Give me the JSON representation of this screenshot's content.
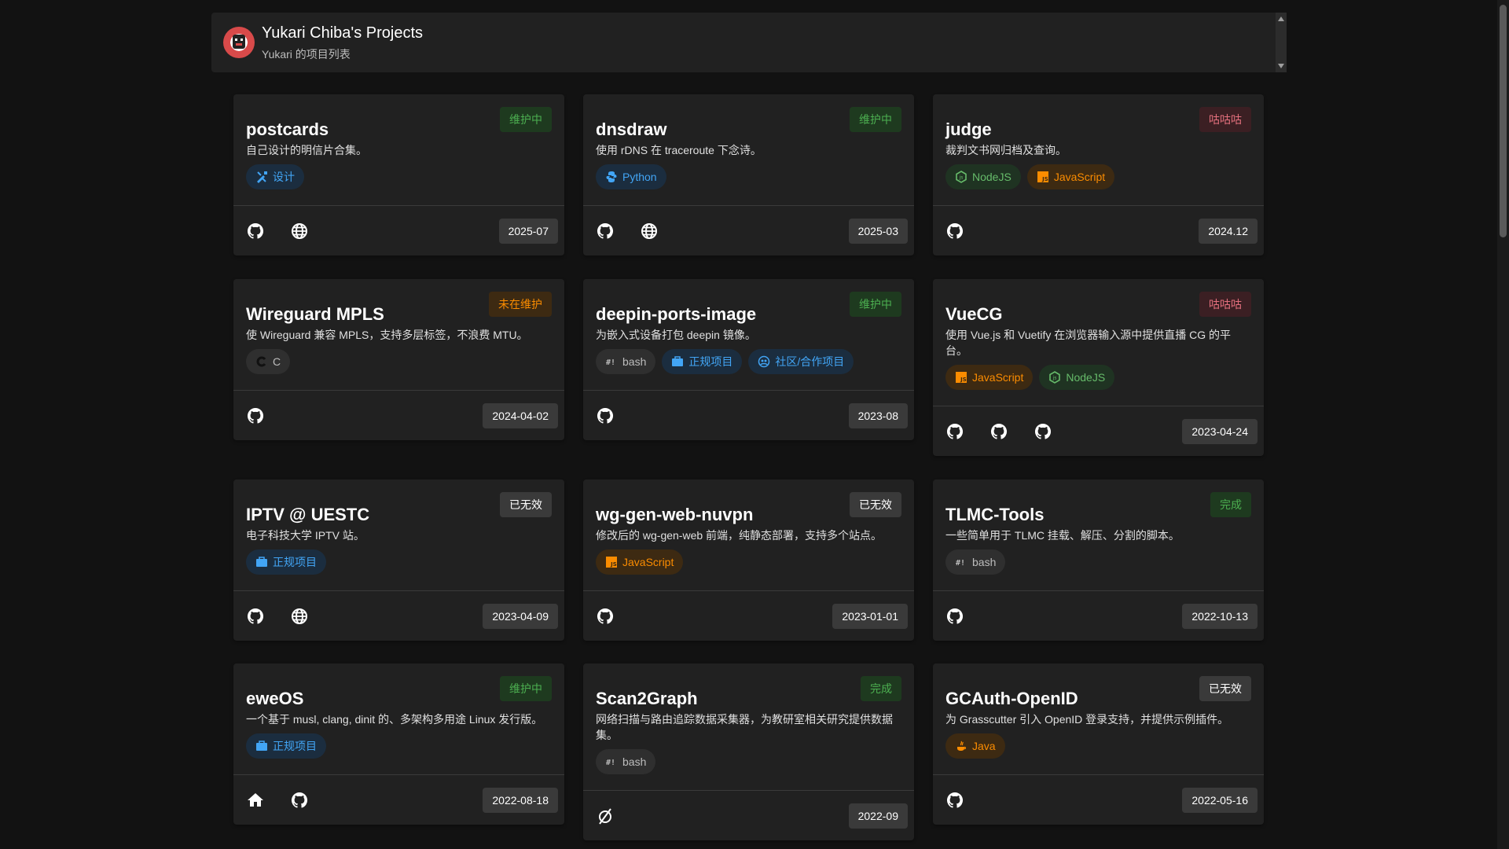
{
  "header": {
    "title": "Yukari Chiba's Projects",
    "subtitle": "Yukari 的项目列表"
  },
  "icons": {
    "github": "github-icon",
    "web": "globe-icon",
    "home": "home-icon",
    "none": "empty-set-icon"
  },
  "colors": {
    "background": "#121212",
    "card": "#212121",
    "green": "#4caf50",
    "red": "#e5707e",
    "orange": "#fb8c00",
    "blue": "#42a5f5"
  },
  "projects": [
    {
      "title": "postcards",
      "status": "维护中",
      "desc": "自己设计的明信片合集。",
      "tags": [
        {
          "label": "设计",
          "icon": "design-icon"
        }
      ],
      "date": "2025-07",
      "links": [
        "github",
        "web"
      ]
    },
    {
      "title": "dnsdraw",
      "status": "维护中",
      "desc": "使用 rDNS 在 traceroute 下念诗。",
      "tags": [
        {
          "label": "Python",
          "icon": "python-icon"
        }
      ],
      "date": "2025-03",
      "links": [
        "github",
        "web"
      ]
    },
    {
      "title": "judge",
      "status": "咕咕咕",
      "desc": "裁判文书网归档及查询。",
      "tags": [
        {
          "label": "NodeJS",
          "icon": "nodejs-icon"
        },
        {
          "label": "JavaScript",
          "icon": "javascript-icon"
        }
      ],
      "date": "2024.12",
      "links": [
        "github"
      ]
    },
    {
      "title": "Wireguard MPLS",
      "status": "未在维护",
      "desc": "使 Wireguard 兼容 MPLS，支持多层标签，不浪费 MTU。",
      "tags": [
        {
          "label": "C",
          "icon": "c-icon"
        }
      ],
      "date": "2024-04-02",
      "links": [
        "github"
      ]
    },
    {
      "title": "deepin-ports-image",
      "status": "维护中",
      "desc": "为嵌入式设备打包 deepin 镜像。",
      "tags": [
        {
          "label": "bash",
          "icon": "bash-icon"
        },
        {
          "label": "正规项目",
          "icon": "briefcase-icon"
        },
        {
          "label": "社区/合作项目",
          "icon": "community-icon"
        }
      ],
      "date": "2023-08",
      "links": [
        "github"
      ]
    },
    {
      "title": "VueCG",
      "status": "咕咕咕",
      "desc": "使用 Vue.js 和 Vuetify 在浏览器输入源中提供直播 CG 的平台。",
      "tags": [
        {
          "label": "JavaScript",
          "icon": "javascript-icon"
        },
        {
          "label": "NodeJS",
          "icon": "nodejs-icon"
        }
      ],
      "date": "2023-04-24",
      "links": [
        "github",
        "github",
        "github"
      ]
    },
    {
      "title": "IPTV @ UESTC",
      "status": "已无效",
      "desc": "电子科技大学 IPTV 站。",
      "tags": [
        {
          "label": "正规项目",
          "icon": "briefcase-icon"
        }
      ],
      "date": "2023-04-09",
      "links": [
        "github",
        "web"
      ]
    },
    {
      "title": "wg-gen-web-nuvpn",
      "status": "已无效",
      "desc": "修改后的 wg-gen-web 前端，纯静态部署，支持多个站点。",
      "tags": [
        {
          "label": "JavaScript",
          "icon": "javascript-icon"
        }
      ],
      "date": "2023-01-01",
      "links": [
        "github"
      ]
    },
    {
      "title": "TLMC-Tools",
      "status": "完成",
      "desc": "一些简单用于 TLMC 挂载、解压、分割的脚本。",
      "tags": [
        {
          "label": "bash",
          "icon": "bash-icon"
        }
      ],
      "date": "2022-10-13",
      "links": [
        "github"
      ]
    },
    {
      "title": "eweOS",
      "status": "维护中",
      "desc": "一个基于 musl, clang, dinit 的、多架构多用途 Linux 发行版。",
      "tags": [
        {
          "label": "正规项目",
          "icon": "briefcase-icon"
        }
      ],
      "date": "2022-08-18",
      "links": [
        "home",
        "github"
      ]
    },
    {
      "title": "Scan2Graph",
      "status": "完成",
      "desc": "网络扫描与路由追踪数据采集器，为教研室相关研究提供数据集。",
      "tags": [
        {
          "label": "bash",
          "icon": "bash-icon"
        }
      ],
      "date": "2022-09",
      "links": [
        "none"
      ]
    },
    {
      "title": "GCAuth-OpenID",
      "status": "已无效",
      "desc": "为 Grasscutter 引入 OpenID 登录支持，并提供示例插件。",
      "tags": [
        {
          "label": "Java",
          "icon": "java-icon"
        }
      ],
      "date": "2022-05-16",
      "links": [
        "github"
      ]
    }
  ]
}
